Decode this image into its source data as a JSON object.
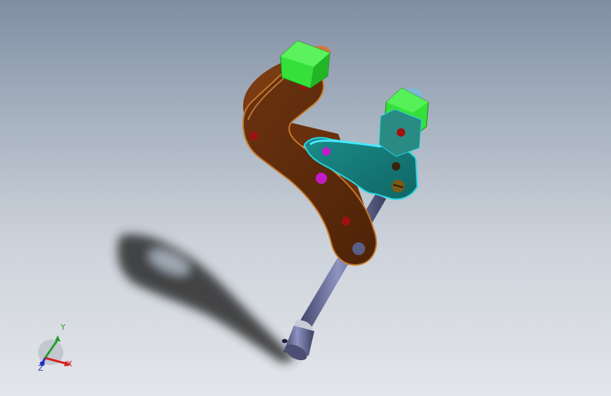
{
  "viewport": {
    "background_top": "#7f8ea3",
    "background_bottom": "#e3e6ea"
  },
  "model": {
    "parts": [
      {
        "name": "bracket-arm",
        "color": "#5a2a0c",
        "edge_color": "#c87a2a"
      },
      {
        "name": "connector-link",
        "color": "#147a78",
        "edge_color": "#28d6e6"
      },
      {
        "name": "clamp-block-top",
        "color": "#36e03a"
      },
      {
        "name": "clamp-block-right",
        "color": "#36e03a"
      },
      {
        "name": "support-rod",
        "color": "#5a5f86"
      }
    ],
    "pin_color": "#a01010",
    "highlight_pin_color": "#c21ac8"
  },
  "triad": {
    "x_label": "X",
    "y_label": "Y",
    "z_label": "Z",
    "x_color": "#d42020",
    "y_color": "#22a02a",
    "z_color": "#2030c0"
  }
}
